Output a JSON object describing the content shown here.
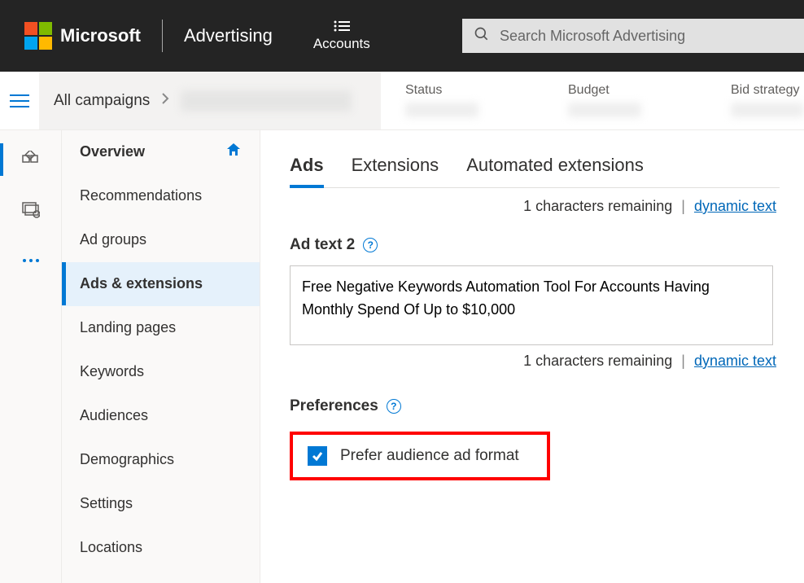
{
  "header": {
    "brand": "Microsoft",
    "product": "Advertising",
    "accounts_label": "Accounts",
    "search_placeholder": "Search Microsoft Advertising"
  },
  "breadcrumb": {
    "root": "All campaigns"
  },
  "stats": {
    "status_label": "Status",
    "budget_label": "Budget",
    "bid_label": "Bid strategy"
  },
  "sidenav": {
    "items": [
      {
        "label": "Overview"
      },
      {
        "label": "Recommendations"
      },
      {
        "label": "Ad groups"
      },
      {
        "label": "Ads & extensions"
      },
      {
        "label": "Landing pages"
      },
      {
        "label": "Keywords"
      },
      {
        "label": "Audiences"
      },
      {
        "label": "Demographics"
      },
      {
        "label": "Settings"
      },
      {
        "label": "Locations"
      }
    ]
  },
  "tabs": {
    "ads": "Ads",
    "extensions": "Extensions",
    "auto": "Automated extensions"
  },
  "form": {
    "remaining1": "1 characters remaining",
    "dyn_text": "dynamic text",
    "ad_text2_label": "Ad text 2",
    "ad_text2_value": "Free Negative Keywords Automation Tool For Accounts Having Monthly Spend Of Up to $10,000",
    "remaining2": "1 characters remaining",
    "preferences_label": "Preferences",
    "prefer_audience": "Prefer audience ad format"
  }
}
